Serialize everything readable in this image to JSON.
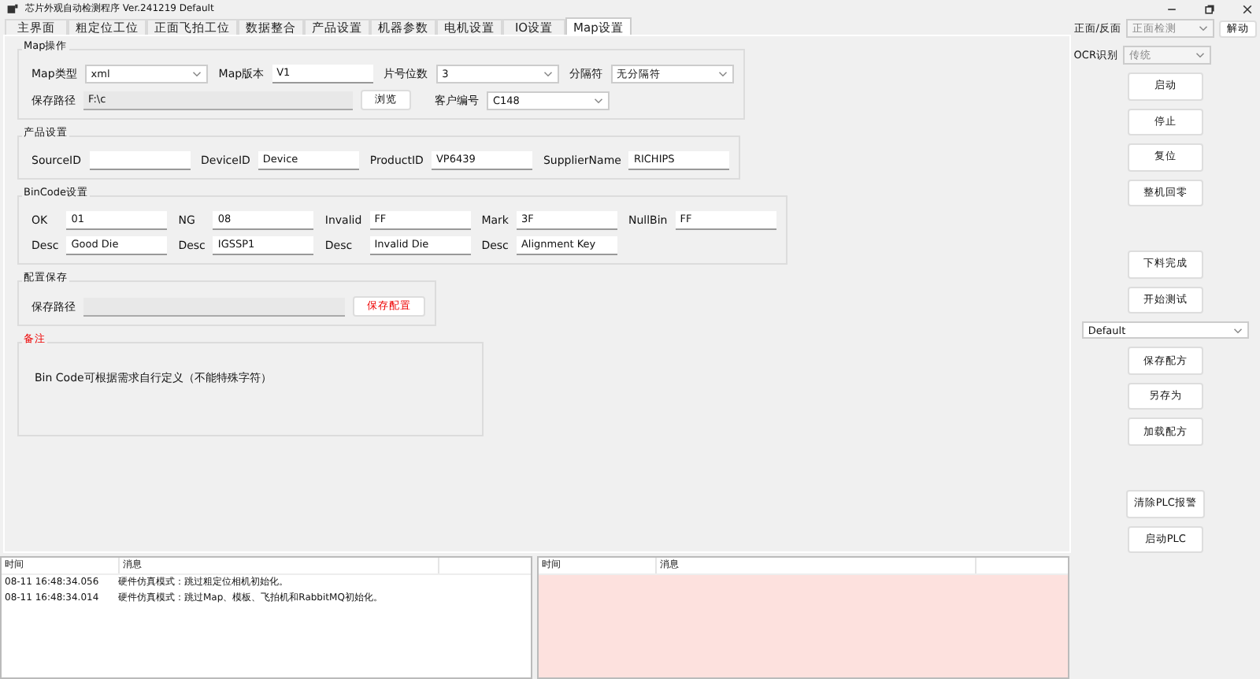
{
  "window": {
    "title": "芯片外观自动检测程序 Ver.241219 Default"
  },
  "tabs": [
    {
      "label": "主界面",
      "selected": false
    },
    {
      "label": "粗定位工位",
      "selected": false
    },
    {
      "label": "正面飞拍工位",
      "selected": false
    },
    {
      "label": "数据整合",
      "selected": false
    },
    {
      "label": "产品设置",
      "selected": false
    },
    {
      "label": "机器参数",
      "selected": false
    },
    {
      "label": "电机设置",
      "selected": false
    },
    {
      "label": "IO设置",
      "selected": false
    },
    {
      "label": "Map设置",
      "selected": true
    }
  ],
  "sections": [
    {
      "title": "Map操作",
      "warn": false,
      "rows": [
        [
          {
            "kind": "label",
            "text": "Map类型"
          },
          {
            "kind": "select",
            "value": "xml",
            "disabled": false
          },
          {
            "kind": "label",
            "text": "Map版本"
          },
          {
            "kind": "input",
            "value": "V1",
            "disabled": false
          },
          {
            "kind": "label",
            "text": "片号位数"
          },
          {
            "kind": "select",
            "value": "3",
            "disabled": false
          },
          {
            "kind": "label",
            "text": "分隔符"
          },
          {
            "kind": "select",
            "value": "无分隔符",
            "disabled": false
          }
        ]
      ],
      "path_line": {
        "label": "保存路径",
        "value": "F:\\c",
        "disabled": true,
        "button": "浏览",
        "customer_label": "客户编号",
        "customer_value": "C148"
      }
    },
    {
      "title": "产品设置",
      "warn": false,
      "rows": [
        [
          {
            "kind": "label",
            "text": "SourceID"
          },
          {
            "kind": "input",
            "disabled": false
          },
          {
            "kind": "label",
            "text": "DeviceID"
          },
          {
            "kind": "input",
            "value": "Device",
            "disabled": false
          },
          {
            "kind": "label",
            "text": "ProductID"
          },
          {
            "kind": "input",
            "value": "VP6439",
            "disabled": false
          },
          {
            "kind": "label",
            "text": "SupplierName"
          },
          {
            "kind": "input",
            "value": "RICHIPS",
            "disabled": false
          }
        ]
      ]
    },
    {
      "title": "BinCode设置",
      "warn": false,
      "rows": [
        [
          {
            "kind": "label",
            "text": "OK"
          },
          {
            "kind": "input",
            "value": "01",
            "disabled": false
          },
          {
            "kind": "label",
            "text": "NG"
          },
          {
            "kind": "input",
            "value": "08",
            "disabled": false
          },
          {
            "kind": "label",
            "text": "Invalid"
          },
          {
            "kind": "input",
            "value": "FF",
            "disabled": false
          },
          {
            "kind": "label",
            "text": "Mark"
          },
          {
            "kind": "input",
            "value": "3F",
            "disabled": false
          },
          {
            "kind": "label",
            "text": "NullBin"
          },
          {
            "kind": "input",
            "value": "FF",
            "disabled": false
          }
        ],
        [
          {
            "kind": "label",
            "text": "Desc"
          },
          {
            "kind": "input",
            "value": "Good Die",
            "disabled": false
          },
          {
            "kind": "label",
            "text": "Desc"
          },
          {
            "kind": "input",
            "value": "IGSSP1",
            "disabled": false
          },
          {
            "kind": "label",
            "text": "Desc"
          },
          {
            "kind": "input",
            "value": "Invalid Die",
            "disabled": false
          },
          {
            "kind": "label",
            "text": "Desc"
          },
          {
            "kind": "input",
            "value": "Alignment Key",
            "disabled": false
          }
        ]
      ]
    },
    {
      "title": "配置保存",
      "warn": false,
      "rows": [
        [
          {
            "kind": "label",
            "text": "保存路径"
          },
          {
            "kind": "path",
            "disabled": true
          },
          {
            "kind": "warn-button",
            "text": "保存配置"
          }
        ]
      ]
    },
    {
      "title": "备注",
      "warn": true,
      "rows": [
        [
          {
            "kind": "note",
            "text": "Bin Code可根据需求自行定义（不能特殊字符）"
          }
        ]
      ]
    }
  ],
  "side": {
    "mode_label": "正面/反面",
    "mode_value": "正面检测",
    "unlock_button": "解动",
    "ocr_label": "OCR识别",
    "ocr_value": "传统",
    "items": [
      {
        "kind": "button",
        "text": "启动"
      },
      {
        "kind": "button",
        "text": "停止"
      },
      {
        "kind": "button",
        "text": "复位"
      },
      {
        "kind": "button",
        "text": "整机回零"
      },
      {
        "kind": "gap"
      },
      {
        "kind": "button",
        "text": "下料完成"
      },
      {
        "kind": "button",
        "text": "开始测试"
      },
      {
        "kind": "select",
        "text": "Default"
      },
      {
        "kind": "button",
        "text": "保存配方"
      },
      {
        "kind": "button",
        "text": "另存为"
      },
      {
        "kind": "button",
        "text": "加载配方"
      },
      {
        "kind": "gap"
      },
      {
        "kind": "button",
        "text": "清除PLC报警"
      },
      {
        "kind": "button",
        "text": "启动PLC"
      }
    ]
  },
  "logs": [
    {
      "alert": false,
      "columns": [
        "时间",
        "消息"
      ],
      "rows": [
        {
          "time": "08-11 16:48:34.056",
          "message": "硬件仿真模式：跳过粗定位相机初始化。"
        },
        {
          "time": "08-11 16:48:34.014",
          "message": "硬件仿真模式：跳过Map、模板、飞拍机和RabbitMQ初始化。"
        }
      ]
    },
    {
      "alert": true,
      "columns": [
        "时间",
        "消息"
      ]
    }
  ]
}
